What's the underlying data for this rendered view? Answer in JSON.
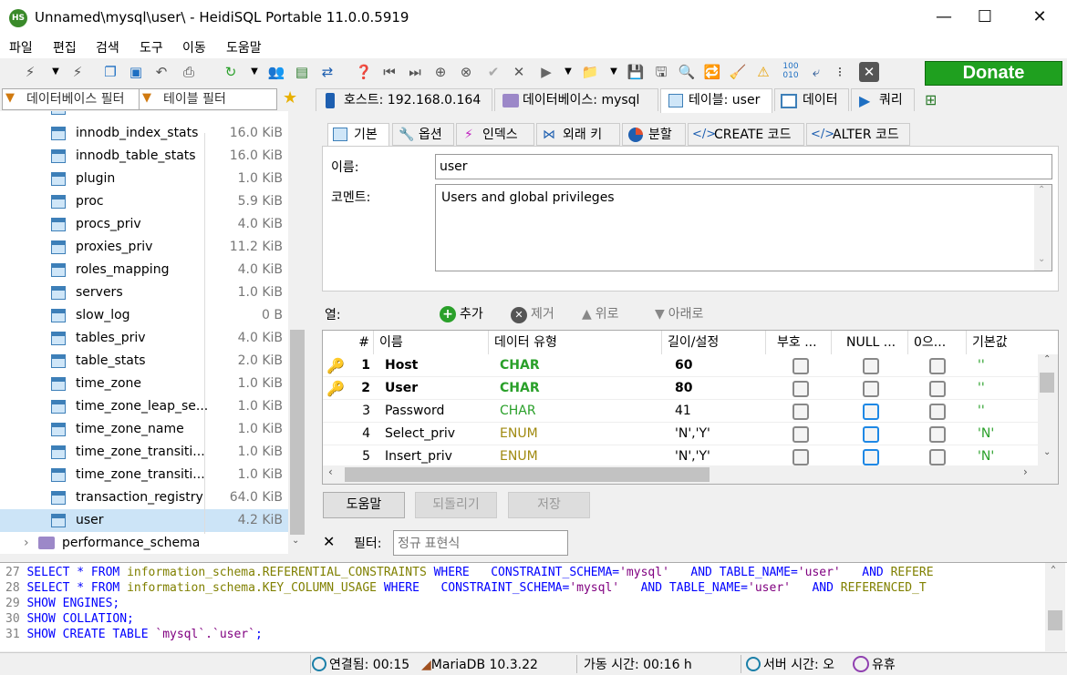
{
  "window": {
    "title": "Unnamed\\mysql\\user\\ - HeidiSQL Portable 11.0.0.5919",
    "app_icon": "HS",
    "minimize": "—",
    "maximize": "☐",
    "close": "✕"
  },
  "menu": [
    "파일",
    "편집",
    "검색",
    "도구",
    "이동",
    "도움말"
  ],
  "donate": "Donate",
  "filters": {
    "db_filter": "데이터베이스 필터",
    "table_filter": "테이블 필터"
  },
  "tree": {
    "items": [
      {
        "name": "innodb_index_stats",
        "size": "16.0 KiB"
      },
      {
        "name": "innodb_table_stats",
        "size": "16.0 KiB"
      },
      {
        "name": "plugin",
        "size": "1.0 KiB"
      },
      {
        "name": "proc",
        "size": "5.9 KiB"
      },
      {
        "name": "procs_priv",
        "size": "4.0 KiB"
      },
      {
        "name": "proxies_priv",
        "size": "11.2 KiB"
      },
      {
        "name": "roles_mapping",
        "size": "4.0 KiB"
      },
      {
        "name": "servers",
        "size": "1.0 KiB"
      },
      {
        "name": "slow_log",
        "size": "0 B"
      },
      {
        "name": "tables_priv",
        "size": "4.0 KiB"
      },
      {
        "name": "table_stats",
        "size": "2.0 KiB"
      },
      {
        "name": "time_zone",
        "size": "1.0 KiB"
      },
      {
        "name": "time_zone_leap_se...",
        "size": "1.0 KiB"
      },
      {
        "name": "time_zone_name",
        "size": "1.0 KiB"
      },
      {
        "name": "time_zone_transiti...",
        "size": "1.0 KiB"
      },
      {
        "name": "time_zone_transiti...",
        "size": "1.0 KiB"
      },
      {
        "name": "transaction_registry",
        "size": "64.0 KiB"
      },
      {
        "name": "user",
        "size": "4.2 KiB"
      }
    ],
    "schema": "performance_schema"
  },
  "tabs": {
    "host": "호스트: 192.168.0.164",
    "database": "데이터베이스: mysql",
    "table": "테이블: user",
    "data": "데이터",
    "query": "쿼리"
  },
  "subtabs": {
    "basic": "기본",
    "options": "옵션",
    "indexes": "인덱스",
    "foreign": "외래 키",
    "partition": "분할",
    "create": "CREATE 코드",
    "alter": "ALTER 코드"
  },
  "form": {
    "name_label": "이름:",
    "name_value": "user",
    "comment_label": "코멘트:",
    "comment_value": "Users and global privileges"
  },
  "columns_bar": {
    "label": "열:",
    "add": "추가",
    "remove": "제거",
    "up": "위로",
    "down": "아래로"
  },
  "grid": {
    "headers": [
      "#",
      "이름",
      "데이터 유형",
      "길이/설정",
      "부호 ...",
      "NULL ...",
      "0으...",
      "기본값"
    ],
    "rows": [
      {
        "num": "1",
        "name": "Host",
        "type": "CHAR",
        "len": "60",
        "def": "''",
        "key": true,
        "bold": true,
        "null_blue": false
      },
      {
        "num": "2",
        "name": "User",
        "type": "CHAR",
        "len": "80",
        "def": "''",
        "key": true,
        "bold": true,
        "null_blue": false
      },
      {
        "num": "3",
        "name": "Password",
        "type": "CHAR",
        "len": "41",
        "def": "''",
        "key": false,
        "bold": false,
        "null_blue": true
      },
      {
        "num": "4",
        "name": "Select_priv",
        "type": "ENUM",
        "len": "'N','Y'",
        "def": "'N'",
        "key": false,
        "bold": false,
        "null_blue": true
      },
      {
        "num": "5",
        "name": "Insert_priv",
        "type": "ENUM",
        "len": "'N','Y'",
        "def": "'N'",
        "key": false,
        "bold": false,
        "null_blue": true
      }
    ]
  },
  "buttons": {
    "help": "도움말",
    "revert": "되돌리기",
    "save": "저장"
  },
  "filter": {
    "label": "필터:",
    "placeholder": "정규 표현식"
  },
  "sql": [
    {
      "n": "27",
      "parts": [
        [
          "kw",
          "SELECT * FROM "
        ],
        [
          "id",
          "information_schema.REFERENTIAL_CONSTRAINTS "
        ],
        [
          "kw",
          "WHERE   CONSTRAINT_SCHEMA="
        ],
        [
          "str",
          "'mysql'"
        ],
        [
          "kw",
          "   AND TABLE_NAME="
        ],
        [
          "str",
          "'user'"
        ],
        [
          "kw",
          "   AND "
        ],
        [
          "id",
          "REFERE"
        ]
      ]
    },
    {
      "n": "28",
      "parts": [
        [
          "kw",
          "SELECT * FROM "
        ],
        [
          "id",
          "information_schema.KEY_COLUMN_USAGE "
        ],
        [
          "kw",
          "WHERE   CONSTRAINT_SCHEMA="
        ],
        [
          "str",
          "'mysql'"
        ],
        [
          "kw",
          "   AND TABLE_NAME="
        ],
        [
          "str",
          "'user'"
        ],
        [
          "kw",
          "   AND "
        ],
        [
          "id",
          "REFERENCED_T"
        ]
      ]
    },
    {
      "n": "29",
      "parts": [
        [
          "kw",
          "SHOW ENGINES;"
        ]
      ]
    },
    {
      "n": "30",
      "parts": [
        [
          "kw",
          "SHOW COLLATION;"
        ]
      ]
    },
    {
      "n": "31",
      "parts": [
        [
          "kw",
          "SHOW CREATE TABLE "
        ],
        [
          "str",
          "`mysql`.`user`"
        ],
        [
          "kw",
          ";"
        ]
      ]
    }
  ],
  "status": {
    "connected": "연결됨: 00:15",
    "server": "MariaDB 10.3.22",
    "uptime": "가동 시간: 00:16 h",
    "server_time": "서버 시간: 오",
    "idle": "유휴"
  }
}
